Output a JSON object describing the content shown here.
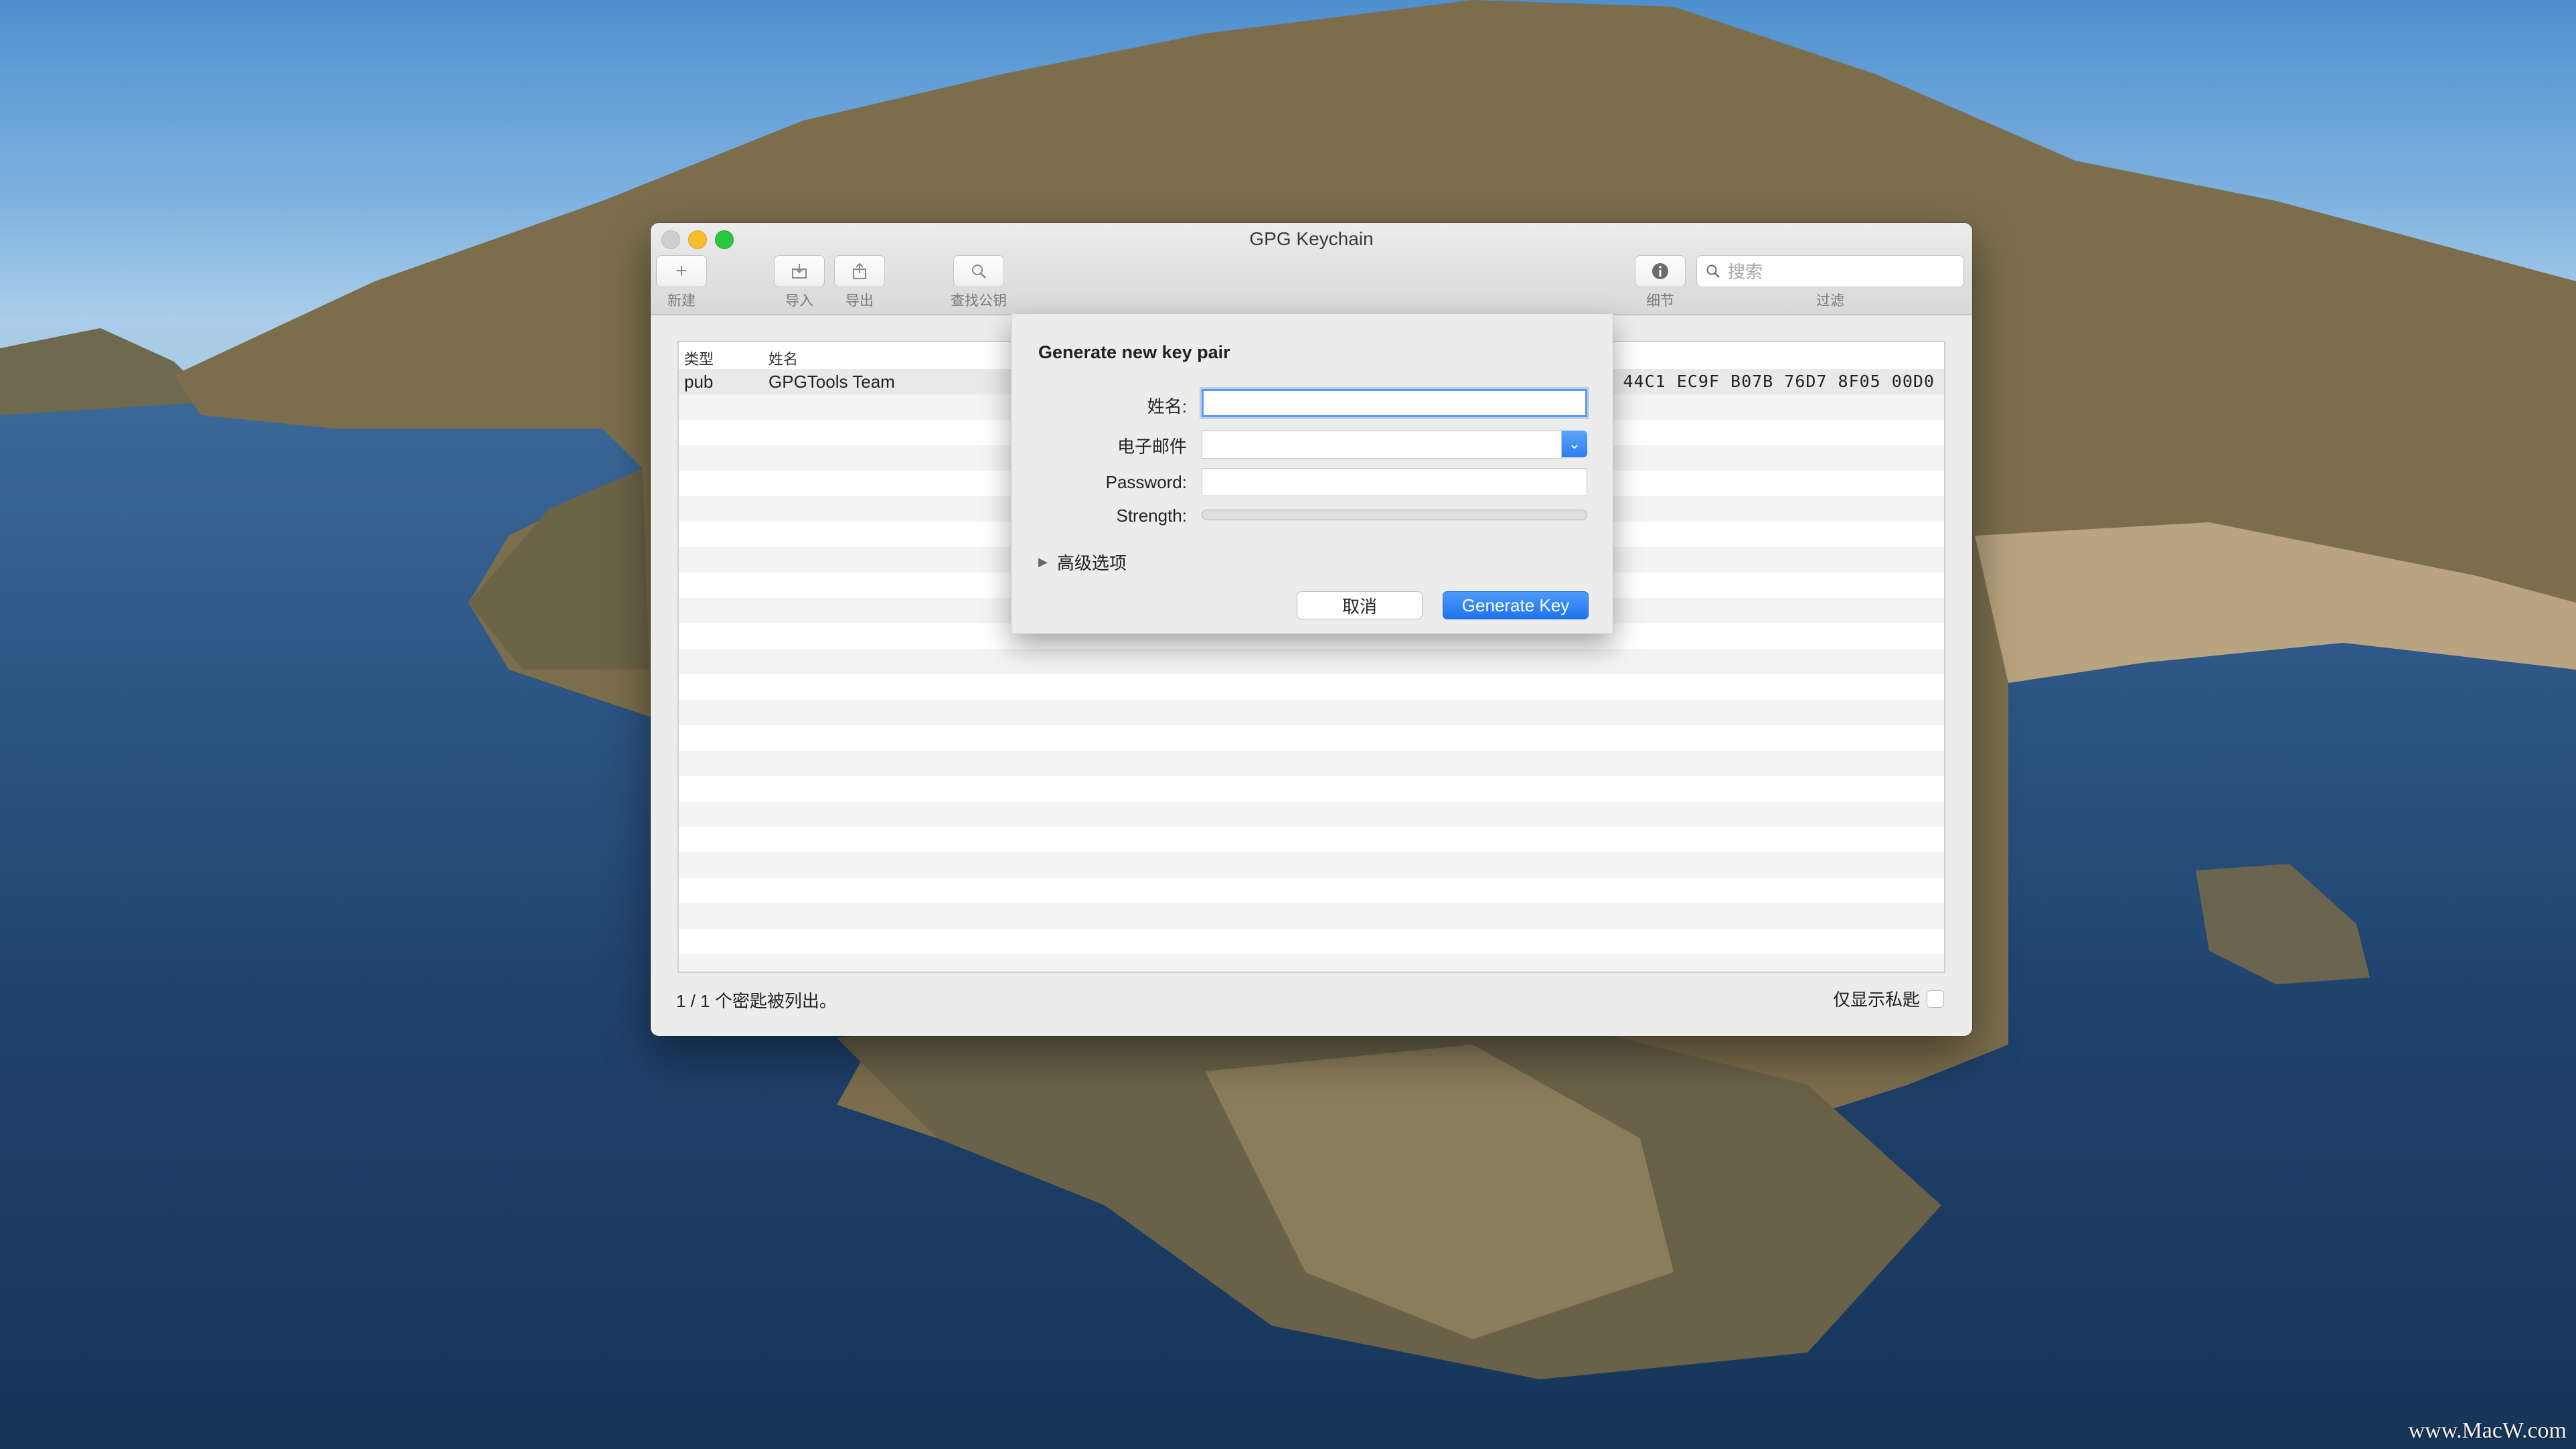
{
  "window": {
    "title": "GPG Keychain"
  },
  "toolbar": {
    "new_label": "新建",
    "import_label": "导入",
    "export_label": "导出",
    "lookup_label": "查找公钥",
    "details_label": "细节",
    "filter_label": "过滤",
    "search_placeholder": "搜索"
  },
  "table": {
    "columns": {
      "type": "类型",
      "name": "姓名"
    },
    "rows": [
      {
        "type": "pub",
        "name": "GPGTools Team",
        "fingerprint_tail": "44C1 EC9F  B07B 76D7 8F05 00D0"
      }
    ]
  },
  "footer": {
    "count_text": "1 / 1 个密匙被列出。",
    "private_only_label": "仅显示私匙"
  },
  "dialog": {
    "title": "Generate new key pair",
    "name_label": "姓名:",
    "email_label": "电子邮件",
    "password_label": "Password:",
    "strength_label": "Strength:",
    "advanced_label": "高级选项",
    "cancel_label": "取消",
    "generate_label": "Generate Key",
    "name_value": "",
    "email_value": "",
    "password_value": "",
    "strength_level": 0
  },
  "icons": {
    "new": "plus-icon",
    "import": "import-icon",
    "export": "share-icon",
    "lookup": "magnifier-icon",
    "details": "info-icon"
  },
  "colors": {
    "accent": "#2d7ef2"
  },
  "watermark": "www.MacW.com"
}
